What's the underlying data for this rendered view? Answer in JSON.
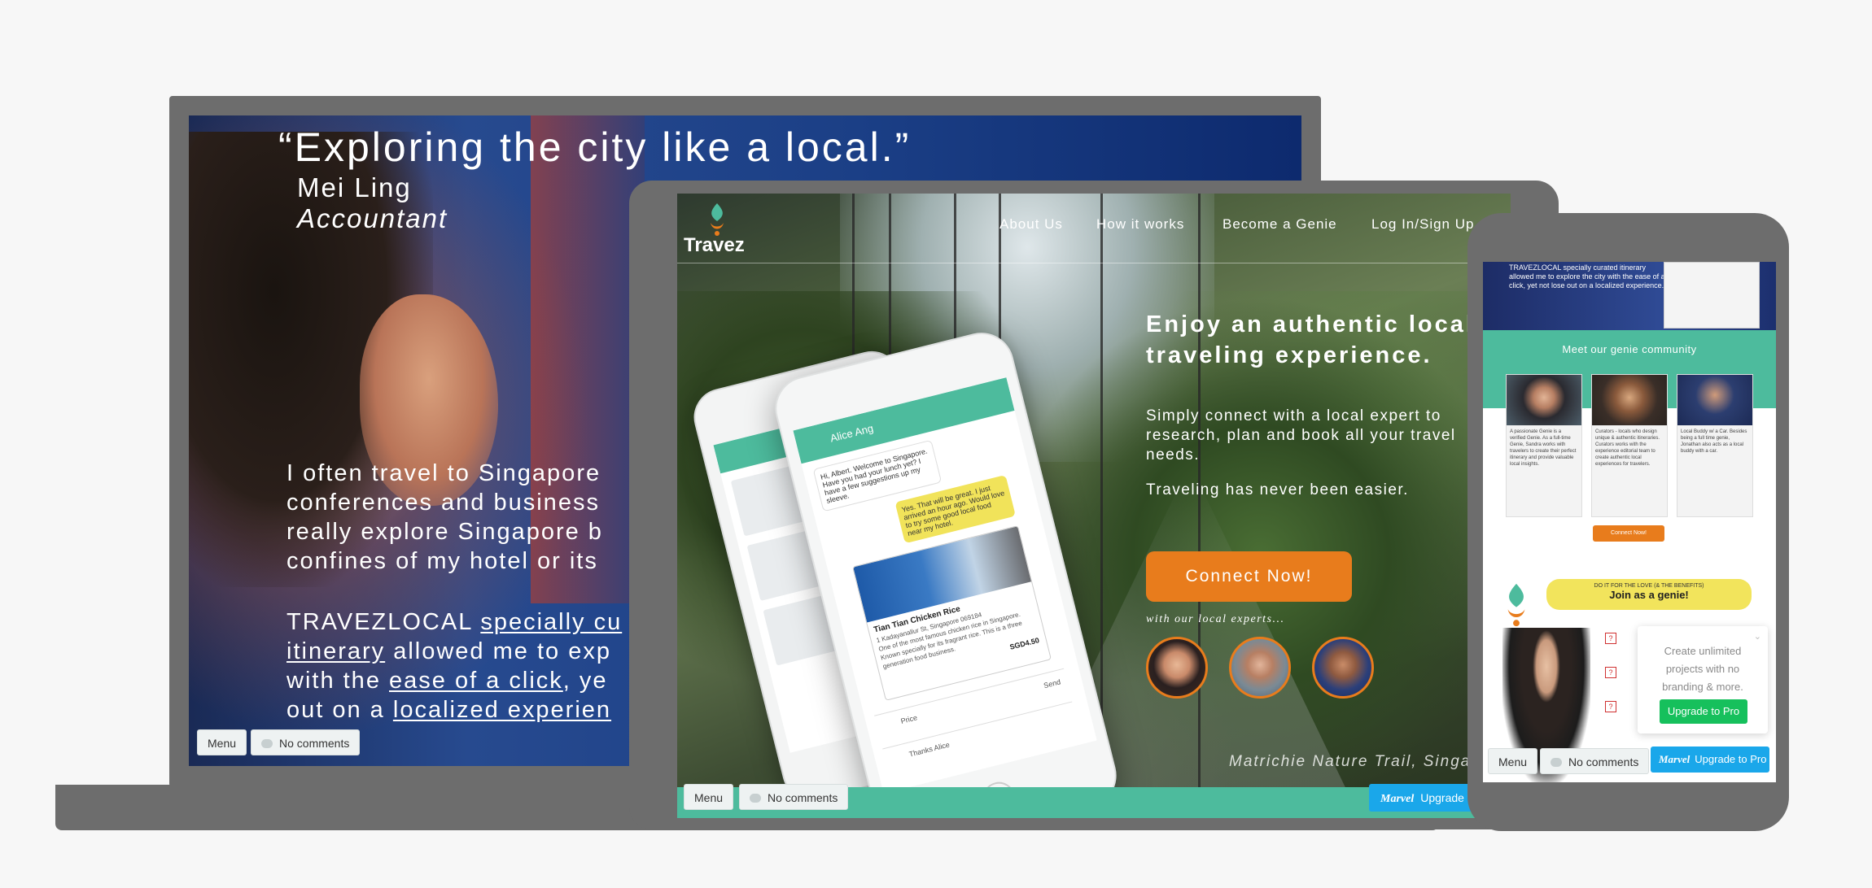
{
  "colors": {
    "teal": "#4dbb9d",
    "orange": "#e87c1c",
    "marvel_blue": "#1aa7ea",
    "pro_green": "#16c05c",
    "device_gray": "#6d6d6d",
    "yellow": "#f2e45c"
  },
  "laptop": {
    "quote": "“Exploring the city like a local.”",
    "name": "Mei Ling",
    "role": "Accountant",
    "body_lines": [
      "I often travel to Singapore",
      "conferences and business",
      "really explore Singapore b",
      "confines of my hotel or its"
    ],
    "body2": {
      "line1_plain": "TRAVEZLOCAL ",
      "line1_link": "specially cu",
      "line2_link": "itinerary",
      "line2_plain": " allowed me to exp",
      "line3_plain": "with the ",
      "line3_link": "ease of a click",
      "line3_tail": ", ye",
      "line4_plain": "out on a ",
      "line4_link": "localized experien"
    },
    "menu_label": "Menu",
    "comments_label": "No comments"
  },
  "tablet": {
    "brand": "Travez",
    "nav": [
      "About Us",
      "How it works",
      "Become a Genie",
      "Log In/Sign Up"
    ],
    "headline": "Enjoy an authentic local traveling experience.",
    "paragraph": "Simply connect with a local expert to research, plan and book all your travel needs.",
    "tagline": "Traveling has never been easier.",
    "cta": "Connect Now!",
    "experts_label": "with our local experts...",
    "caption": "Matrichie Nature Trail, Singap",
    "menu_label": "Menu",
    "comments_label": "No comments",
    "marvel_logo": "Marvel",
    "upgrade_label": "Upgrade to",
    "phone_mockup": {
      "chat_name": "Alice Ang",
      "msg1": "Hi, Albert. Welcome to Singapore. Have you had your lunch yet? I have a few suggestions up my sleeve.",
      "msg2": "Yes. That will be great. I just arrived an hour ago. Would love to try some good local food near my hotel.",
      "card_title": "Tian Tian Chicken Rice",
      "card_address": "1 Kadayanallur St, Singapore 069184",
      "card_text": "One of the most famous chicken rice in Singapore. Known specially for its fragrant rice. This is a three generation food business.",
      "card_price": "SGD4.50",
      "price_label": "Price",
      "send_label": "Send",
      "input_text": "Thanks Alice"
    }
  },
  "phone": {
    "hero_text": "TRAVEZLOCAL specially curated itinerary allowed me to explore the city with the ease of a click, yet not lose out on a localized experience.",
    "meet_title": "Meet our genie community",
    "cards": [
      {
        "title": "Genie",
        "text": "A passionate Genie is a verified Genie. As a full-time Genie, Sandra works with travelers to create their perfect itinerary and provide valuable local insights."
      },
      {
        "title": "Curators",
        "text": "Curators - locals who design unique & authentic itineraries. Curators works with the experience editorial team to create authentic local experiences for travelers."
      },
      {
        "title": "Local Buddy w/ a Car",
        "text": "Local Buddy w/ a Car. Besides being a full time genie, Jonathan also acts as a local buddy with a car."
      }
    ],
    "connect_label": "Connect Now!",
    "join_small": "DO IT FOR THE LOVE (& THE BENEFITS)",
    "join_big": "Join as a genie!",
    "pro_text": "Create unlimited projects with no branding & more.",
    "pro_button": "Upgrade to Pro",
    "menu_label": "Menu",
    "comments_label": "No comments",
    "marvel_logo": "Marvel",
    "upgrade_label": "Upgrade to Pro"
  }
}
